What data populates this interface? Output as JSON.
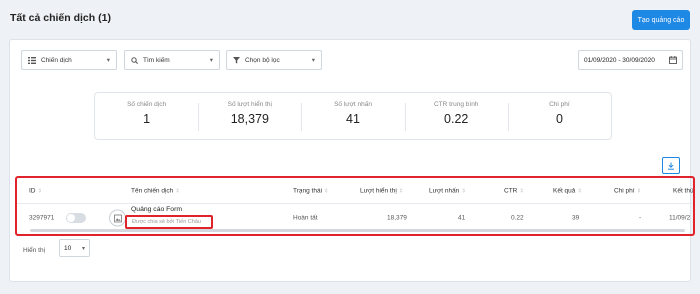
{
  "header": {
    "title": "Tất cả chiến dịch (1)",
    "create_label": "Tạo quảng cáo"
  },
  "filters": {
    "campaign": "Chiến dịch",
    "search": "Tìm kiếm",
    "filter": "Chọn bộ lọc",
    "date_range": "01/09/2020 - 30/09/2020"
  },
  "stats": [
    {
      "label": "Số chiến dịch",
      "value": "1"
    },
    {
      "label": "Số lượt hiển thị",
      "value": "18,379"
    },
    {
      "label": "Số lượt nhấn",
      "value": "41"
    },
    {
      "label": "CTR trung bình",
      "value": "0.22"
    },
    {
      "label": "Chi phí",
      "value": "0"
    }
  ],
  "table": {
    "headers": {
      "id": "ID",
      "name": "Tên chiến dịch",
      "status": "Trạng thái",
      "impressions": "Lượt hiển thị",
      "clicks": "Lượt nhấn",
      "ctr": "CTR",
      "results": "Kết quả",
      "cost": "Chi phí",
      "end": "Kết thú"
    },
    "row": {
      "id": "3297971",
      "name": "Quảng cáo Form",
      "creator": "Được chia sẻ bởi Tiến Châu",
      "status": "Hoàn tất",
      "impressions": "18,379",
      "clicks": "41",
      "ctr": "0.22",
      "results": "39",
      "cost": "-",
      "end": "11/09/2"
    }
  },
  "pagination": {
    "show_label": "Hiển thị",
    "per_page": "10"
  },
  "colors": {
    "accent": "#1e88e5",
    "highlight": "#e0222a"
  }
}
